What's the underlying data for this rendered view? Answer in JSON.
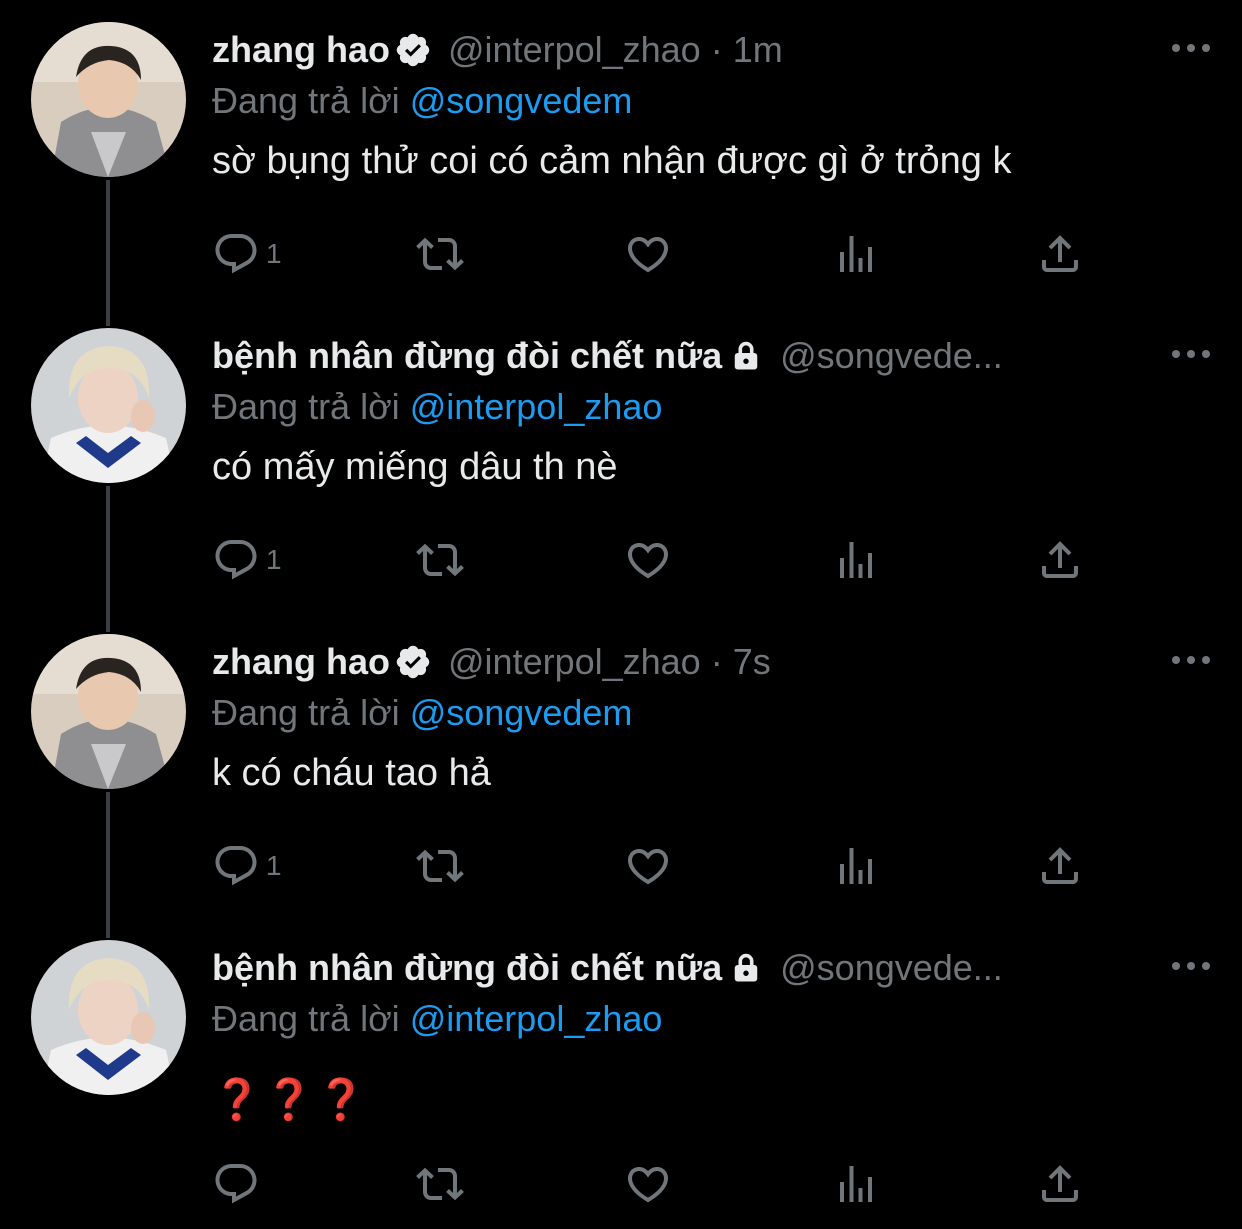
{
  "colors": {
    "background": "#000000",
    "text": "#e7e9ea",
    "muted": "#71767b",
    "link": "#1d9bf0",
    "thread_line": "#3a3f44",
    "emoji_red": "#dd2e44"
  },
  "tweets": [
    {
      "name": "zhang hao",
      "badge": "verified-icon",
      "handle": "@interpol_zhao",
      "separator": "·",
      "time": "1m",
      "reply_prefix": "Đang trả lời",
      "reply_to": "@songvedem",
      "text": "sờ bụng thử coi có cảm nhận được gì ở trỏng k",
      "reply_count": "1"
    },
    {
      "name": "bệnh nhân đừng đòi chết nữa",
      "badge": "lock-icon",
      "handle": "@songvede...",
      "reply_prefix": "Đang trả lời",
      "reply_to": "@interpol_zhao",
      "text": "có mấy miếng dâu th nè",
      "reply_count": "1"
    },
    {
      "name": "zhang hao",
      "badge": "verified-icon",
      "handle": "@interpol_zhao",
      "separator": "·",
      "time": "7s",
      "reply_prefix": "Đang trả lời",
      "reply_to": "@songvedem",
      "text": "k có cháu tao hả",
      "reply_count": "1"
    },
    {
      "name": "bệnh nhân đừng đòi chết nữa",
      "badge": "lock-icon",
      "handle": "@songvede...",
      "reply_prefix": "Đang trả lời",
      "reply_to": "@interpol_zhao",
      "emoji": [
        "❓",
        "❓",
        "❓"
      ],
      "reply_count": ""
    }
  ],
  "icons": {
    "reply": "reply-icon",
    "retweet": "retweet-icon",
    "like": "heart-icon",
    "views": "views-icon",
    "share": "share-icon",
    "more": "more-icon"
  }
}
